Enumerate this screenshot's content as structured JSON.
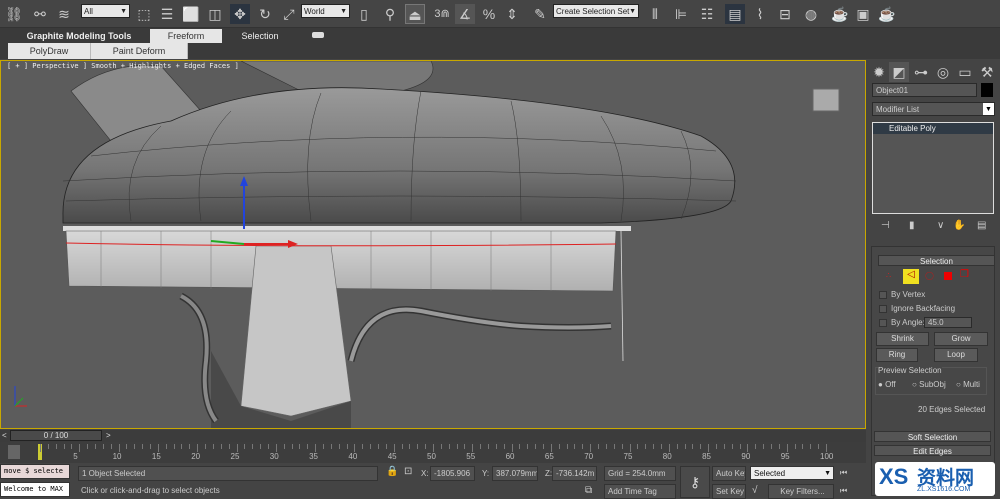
{
  "toolbar": {
    "filter": "All",
    "coord_system": "World",
    "snap_label": "3",
    "selection_set": "Create Selection Set",
    "icons": [
      "link-icon",
      "unlink-icon",
      "bind-spacewarp-icon",
      "select-object-icon",
      "select-by-name-icon",
      "rect-selection-icon",
      "window-crossing-icon",
      "move-icon",
      "rotate-icon",
      "scale-icon",
      "pivot-icon",
      "manipulate-icon",
      "keyboard-shortcut-icon",
      "snap-icon",
      "angle-snap-icon",
      "percent-snap-icon",
      "spinner-snap-icon",
      "edit-named-sets-icon",
      "mirror-icon",
      "align-icon",
      "layer-manager-icon",
      "scene-explorer-icon",
      "curve-editor-icon",
      "schematic-view-icon",
      "material-editor-icon",
      "render-setup-icon",
      "rendered-frame-icon",
      "render-icon"
    ]
  },
  "ribbon": {
    "tabs": [
      "Graphite Modeling Tools",
      "Freeform",
      "Selection"
    ],
    "active_tab": "Freeform",
    "sub_buttons": [
      "PolyDraw",
      "Paint Deform"
    ]
  },
  "viewport": {
    "label": "[ + ] Perspective ] Smooth + Highlights + Edged Faces ]"
  },
  "panel": {
    "object_name": "Object01",
    "modifier_list": "Modifier List",
    "stack_item": "Editable Poly",
    "selection": {
      "title": "Selection",
      "by_vertex": "By Vertex",
      "ignore_backfacing": "Ignore Backfacing",
      "by_angle": "By Angle:",
      "angle_value": "45.0",
      "shrink": "Shrink",
      "grow": "Grow",
      "ring": "Ring",
      "loop": "Loop",
      "preview_title": "Preview Selection",
      "preview_options": [
        "Off",
        "SubObj",
        "Multi"
      ],
      "preview_selected": "Off",
      "status": "20 Edges Selected",
      "active_subobject": "edge"
    },
    "soft_selection": "Soft Selection",
    "edit_edges": "Edit Edges"
  },
  "timeline": {
    "frame": "0 / 100",
    "ticks": [
      "0",
      "5",
      "10",
      "15",
      "20",
      "25",
      "30",
      "35",
      "40",
      "45",
      "50",
      "55",
      "60",
      "65",
      "70",
      "75",
      "80",
      "85",
      "90",
      "95",
      "100"
    ]
  },
  "status": {
    "maxscript_1": "move $ selecte",
    "maxscript_2": "Welcome to MAX",
    "selected": "1 Object Selected",
    "prompt": "Click or click-and-drag to select objects",
    "x_label": "X:",
    "x": "-1805.906",
    "y_label": "Y:",
    "y": "387.079mm",
    "z_label": "Z:",
    "z": "-736.142m",
    "grid": "Grid = 254.0mm",
    "add_time_tag": "Add Time Tag",
    "auto_key": "Auto Key",
    "set_key": "Set Key",
    "key_mode": "Selected",
    "key_filters": "Key Filters..."
  },
  "watermark": {
    "text": "资料网",
    "url": "ZL.XS1616.COM"
  }
}
